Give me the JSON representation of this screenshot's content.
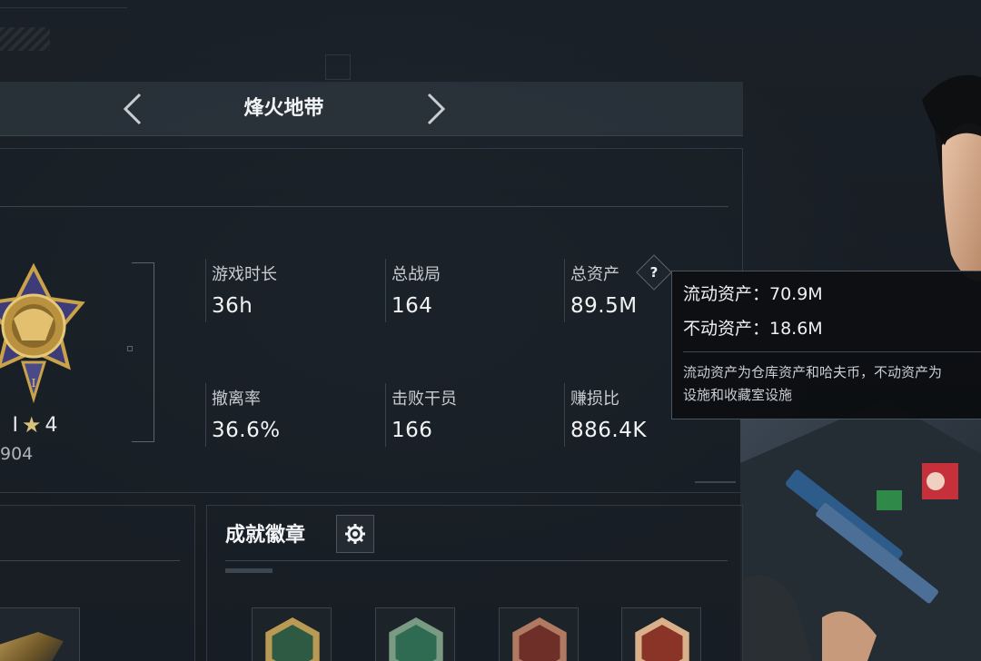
{
  "header": {
    "title": "烽火地带",
    "prev_icon": "chevron-left-icon",
    "next_icon": "chevron-right-icon"
  },
  "rank": {
    "name_partial": "I",
    "stars": "4",
    "score_partial": "904"
  },
  "stats": {
    "playtime": {
      "label": "游戏时长",
      "value": "36h"
    },
    "total_matches": {
      "label": "总战局",
      "value": "164"
    },
    "total_assets": {
      "label": "总资产",
      "value": "89.5M",
      "help_icon": "question-icon"
    },
    "extraction_rate": {
      "label": "撤离率",
      "value": "36.6%"
    },
    "operators_defeated": {
      "label": "击败干员",
      "value": "166"
    },
    "profit_ratio": {
      "label": "赚损比",
      "value": "886.4K"
    }
  },
  "tooltip": {
    "liquid_assets": "流动资产：70.9M",
    "fixed_assets": "不动资产：18.6M",
    "desc_line1": "流动资产为仓库资产和哈夫币，不动资产为",
    "desc_line2": "设施和收藏室设施"
  },
  "achievements": {
    "title": "成就徽章",
    "settings_icon": "gear-icon",
    "badges": [
      "badge-wasp-icon",
      "badge-tools-icon",
      "badge-dragon-icon",
      "badge-runner-icon"
    ]
  },
  "colors": {
    "background": "#171c22",
    "panel_border": "#303a44",
    "medal_gold": "#c9a24a",
    "medal_purple": "#4a4a8a"
  }
}
